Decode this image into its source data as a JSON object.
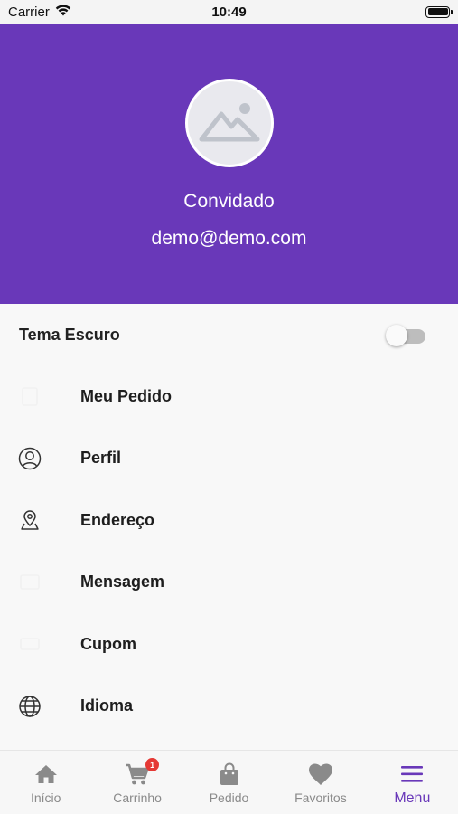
{
  "status_bar": {
    "carrier": "Carrier",
    "time": "10:49"
  },
  "profile": {
    "name": "Convidado",
    "email": "demo@demo.com"
  },
  "theme": {
    "label": "Tema Escuro",
    "dark_mode_enabled": false
  },
  "menu": {
    "items": [
      {
        "label": "Meu Pedido",
        "icon": "order-icon"
      },
      {
        "label": "Perfil",
        "icon": "profile-icon"
      },
      {
        "label": "Endereço",
        "icon": "location-icon"
      },
      {
        "label": "Mensagem",
        "icon": "message-icon"
      },
      {
        "label": "Cupom",
        "icon": "coupon-icon"
      },
      {
        "label": "Idioma",
        "icon": "globe-icon"
      }
    ]
  },
  "tabs": [
    {
      "label": "Início",
      "icon": "home-icon",
      "active": false
    },
    {
      "label": "Carrinho",
      "icon": "cart-icon",
      "active": false,
      "badge": "1"
    },
    {
      "label": "Pedido",
      "icon": "bag-icon",
      "active": false
    },
    {
      "label": "Favoritos",
      "icon": "heart-icon",
      "active": false
    },
    {
      "label": "Menu",
      "icon": "menu-icon",
      "active": true
    }
  ],
  "colors": {
    "primary": "#6938b9",
    "tab_inactive": "#8a8a8a",
    "badge": "#e53935"
  }
}
